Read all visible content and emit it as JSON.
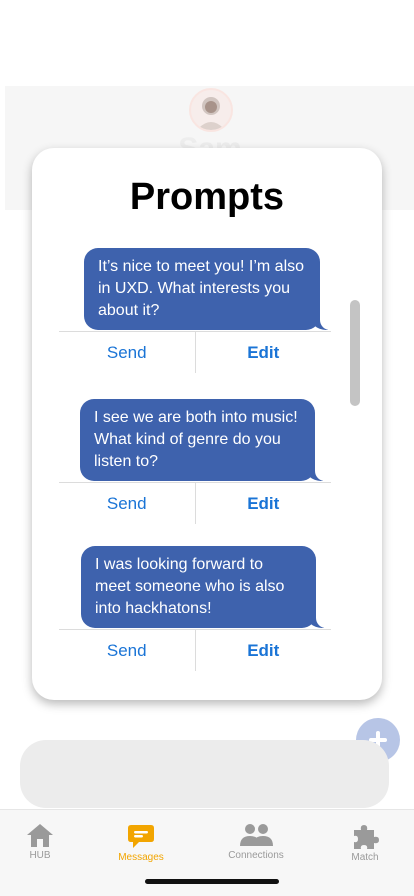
{
  "background": {
    "contact_name": "Sam"
  },
  "modal": {
    "title": "Prompts",
    "prompts": [
      {
        "text": "It’s nice to meet you! I’m also in UXD. What interests you about it?",
        "send_label": "Send",
        "edit_label": "Edit"
      },
      {
        "text": "I see we are both into music! What kind of genre do you listen to?",
        "send_label": "Send",
        "edit_label": "Edit"
      },
      {
        "text": "I was looking forward to meet someone who is also into hackhatons!",
        "send_label": "Send",
        "edit_label": "Edit"
      }
    ]
  },
  "fab": {
    "icon": "plus-icon"
  },
  "tabbar": {
    "items": [
      {
        "label": "HUB",
        "icon": "home-icon"
      },
      {
        "label": "Messages",
        "icon": "chat-icon",
        "active": true
      },
      {
        "label": "Connections",
        "icon": "people-icon"
      },
      {
        "label": "Match",
        "icon": "puzzle-icon"
      }
    ]
  },
  "colors": {
    "bubble": "#3e62ad",
    "link": "#1a74d6",
    "active_tab": "#f2a500",
    "inactive_tab": "#9a9a9a"
  }
}
